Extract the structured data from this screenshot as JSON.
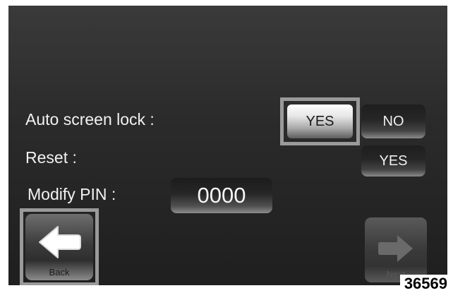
{
  "settings": {
    "auto_lock": {
      "label": "Auto screen lock :",
      "yes_label": "YES",
      "no_label": "NO",
      "selected": "YES"
    },
    "reset": {
      "label": "Reset :",
      "yes_label": "YES"
    },
    "modify_pin": {
      "label": "Modify PIN :",
      "value": "0000"
    }
  },
  "nav": {
    "back": {
      "label": "Back",
      "icon": "arrow-left-icon"
    },
    "next": {
      "label": "Next",
      "icon": "arrow-right-icon",
      "enabled": false
    }
  },
  "figure_id": "36569",
  "colors": {
    "screen_bg": "#2b2b2b",
    "text": "#f2f2f2",
    "focus_ring": "#9a9a9a"
  }
}
